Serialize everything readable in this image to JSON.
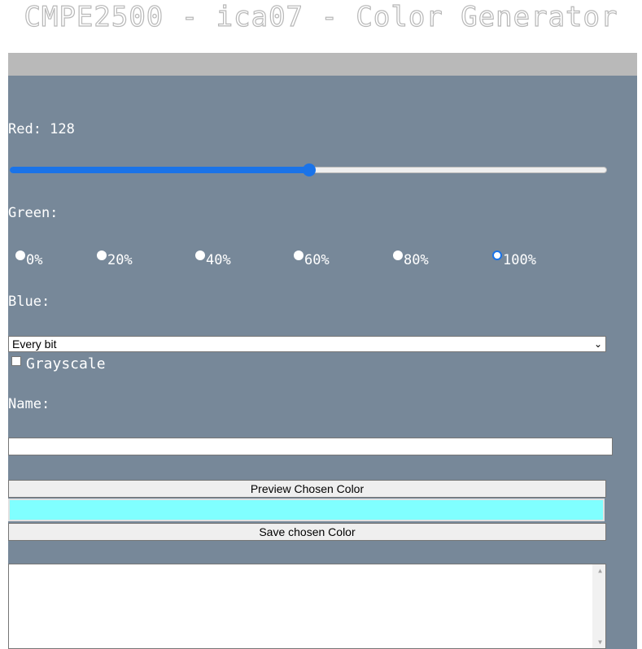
{
  "page_title": "CMPE2500 - ica07 - Color Generator",
  "red": {
    "label": "Red: 128",
    "value": 128,
    "max": 255
  },
  "green": {
    "label": "Green:",
    "options": [
      "0%",
      "20%",
      "40%",
      "60%",
      "80%",
      "100%"
    ],
    "selected": "100%"
  },
  "blue": {
    "label": "Blue:",
    "selected": "Every bit"
  },
  "grayscale": {
    "label": "Grayscale",
    "checked": false
  },
  "name": {
    "label": "Name:",
    "value": ""
  },
  "buttons": {
    "preview": "Preview Chosen Color",
    "save": "Save chosen Color"
  },
  "preview_color": "#80ffff",
  "accent_color": "#1a73e8",
  "panel_color": "#778899",
  "saved_list": ""
}
